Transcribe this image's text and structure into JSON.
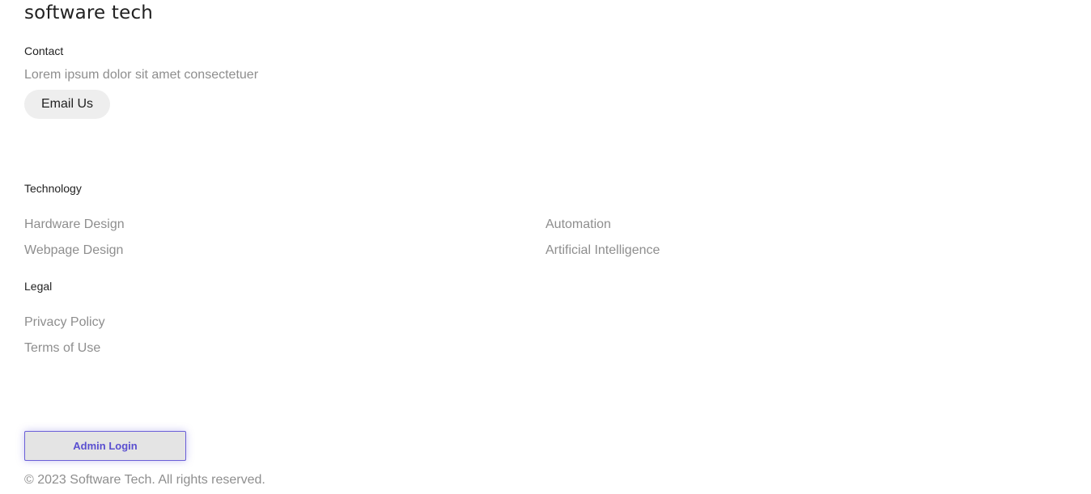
{
  "brand": {
    "title": "software tech"
  },
  "contact": {
    "heading": "Contact",
    "description": "Lorem ipsum dolor sit amet consectetuer",
    "email_button": "Email Us"
  },
  "technology": {
    "heading": "Technology",
    "links": [
      "Hardware Design",
      "Webpage Design",
      "Automation",
      "Artificial Intelligence"
    ]
  },
  "legal": {
    "heading": "Legal",
    "links": [
      "Privacy Policy",
      "Terms of Use"
    ]
  },
  "admin": {
    "button": "Admin Login"
  },
  "footer": {
    "copyright": "© 2023 Software Tech. All rights reserved."
  },
  "colors": {
    "text": "#222222",
    "muted_text": "#8e8e8e",
    "email_button_bg": "#eeeeee",
    "admin_button_bg": "#e4e4e4",
    "admin_accent": "#5a4fd0"
  }
}
